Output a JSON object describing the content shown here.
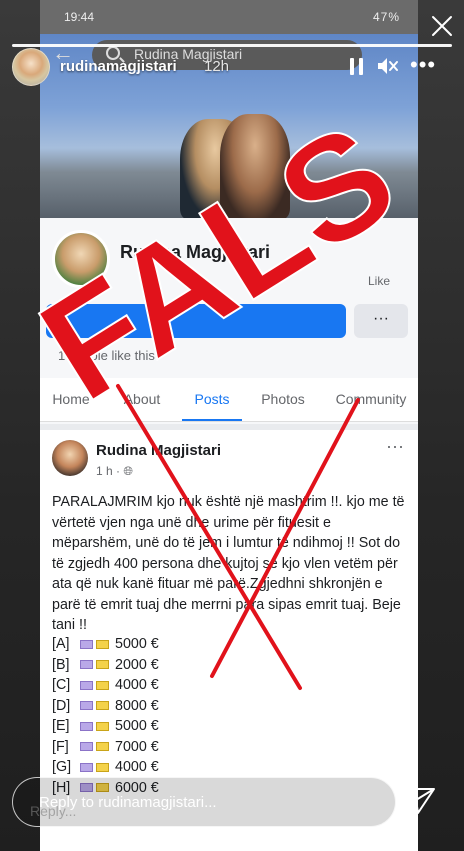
{
  "phone_status": {
    "time": "19:44",
    "battery": "47%"
  },
  "fb_search": {
    "value": "Rudina Magjistari"
  },
  "page": {
    "name": "Rudina Magjistari",
    "like_label": "Like",
    "likes_text": "1 people like this"
  },
  "tabs": [
    "Home",
    "About",
    "Posts",
    "Photos",
    "Community"
  ],
  "post": {
    "author": "Rudina Magjistari",
    "time": "1 h · ",
    "text": "PARALAJMRIM kjo nuk është një mashtrim !!. kjo me të vërtetë vjen nga unë dhe urime për fituesit e mëparshëm, unë do të jem i lumtur të ndihmoj !! Sot do të zgjedh 400 persona dhe kujtoj se kjo vlen vetëm për ata që nuk kanë fituar më parë.Zgjedhni shkronjën e parë të emrit tuaj dhe merrni para sipas emrit tuaj. Beje tani !!",
    "prizes": [
      {
        "letter": "[A]",
        "amount": "5000 €"
      },
      {
        "letter": "[B]",
        "amount": "2000 €"
      },
      {
        "letter": "[C]",
        "amount": "4000 €"
      },
      {
        "letter": "[D]",
        "amount": "8000 €"
      },
      {
        "letter": "[E]",
        "amount": "5000 €"
      },
      {
        "letter": "[F]",
        "amount": "7000 €"
      },
      {
        "letter": "[G]",
        "amount": "4000 €"
      },
      {
        "letter": "[H]",
        "amount": "6000 €"
      }
    ]
  },
  "watermark": {
    "text": "FALS",
    "color": "#e1121b"
  },
  "story": {
    "username": "rudinamagjistari",
    "age": "12h",
    "reply_placeholder": "Reply to rudinamagjistari...",
    "reply_ghost": "Reply..."
  },
  "colors": {
    "facebook_blue": "#1877f2",
    "stamp_red": "#e1121b"
  }
}
